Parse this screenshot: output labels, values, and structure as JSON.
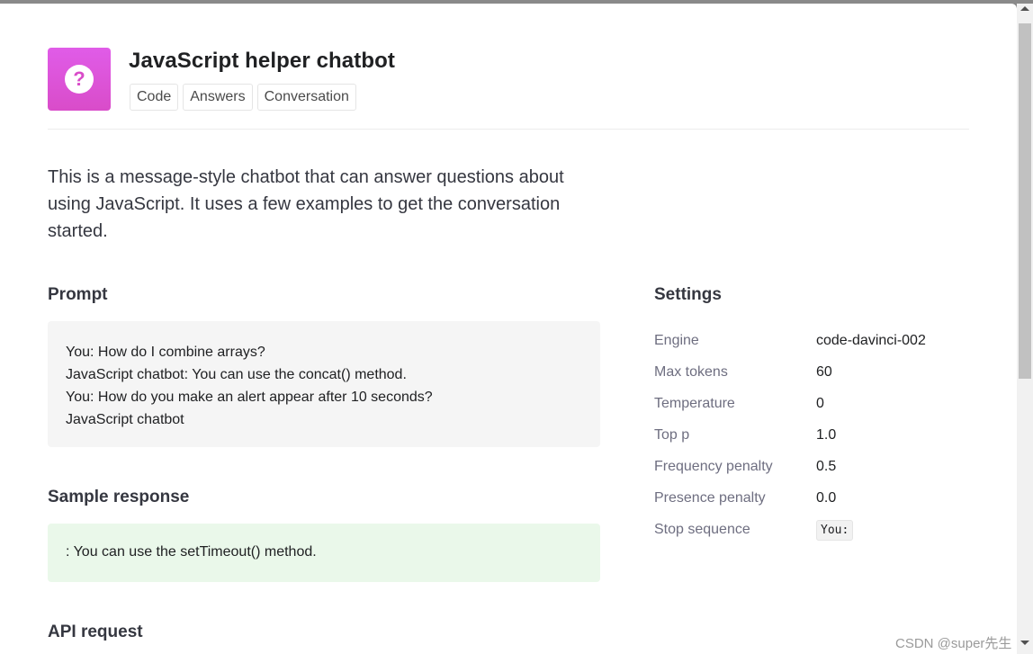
{
  "app": {
    "title": "JavaScript helper chatbot",
    "icon": "question-mark-icon",
    "icon_glyph": "?",
    "tags": [
      "Code",
      "Answers",
      "Conversation"
    ],
    "description": "This is a message-style chatbot that can answer questions about using JavaScript. It uses a few examples to get the conversation started."
  },
  "prompt": {
    "heading": "Prompt",
    "lines": [
      "You: How do I combine arrays?",
      "JavaScript chatbot: You can use the concat() method.",
      "You: How do you make an alert appear after 10 seconds?",
      "JavaScript chatbot"
    ]
  },
  "sample_response": {
    "heading": "Sample response",
    "text": ": You can use the setTimeout() method."
  },
  "api_request": {
    "heading": "API request"
  },
  "settings": {
    "heading": "Settings",
    "rows": [
      {
        "label": "Engine",
        "value": "code-davinci-002"
      },
      {
        "label": "Max tokens",
        "value": "60"
      },
      {
        "label": "Temperature",
        "value": "0"
      },
      {
        "label": "Top p",
        "value": "1.0"
      },
      {
        "label": "Frequency penalty",
        "value": "0.5"
      },
      {
        "label": "Presence penalty",
        "value": "0.0"
      },
      {
        "label": "Stop sequence",
        "value": "You:"
      }
    ]
  },
  "watermark": "CSDN @super先生",
  "colors": {
    "icon_gradient_top": "#e05ce8",
    "icon_gradient_bottom": "#d94cc9",
    "response_bg": "#eaf8ea",
    "prompt_bg": "#f5f5f5"
  }
}
